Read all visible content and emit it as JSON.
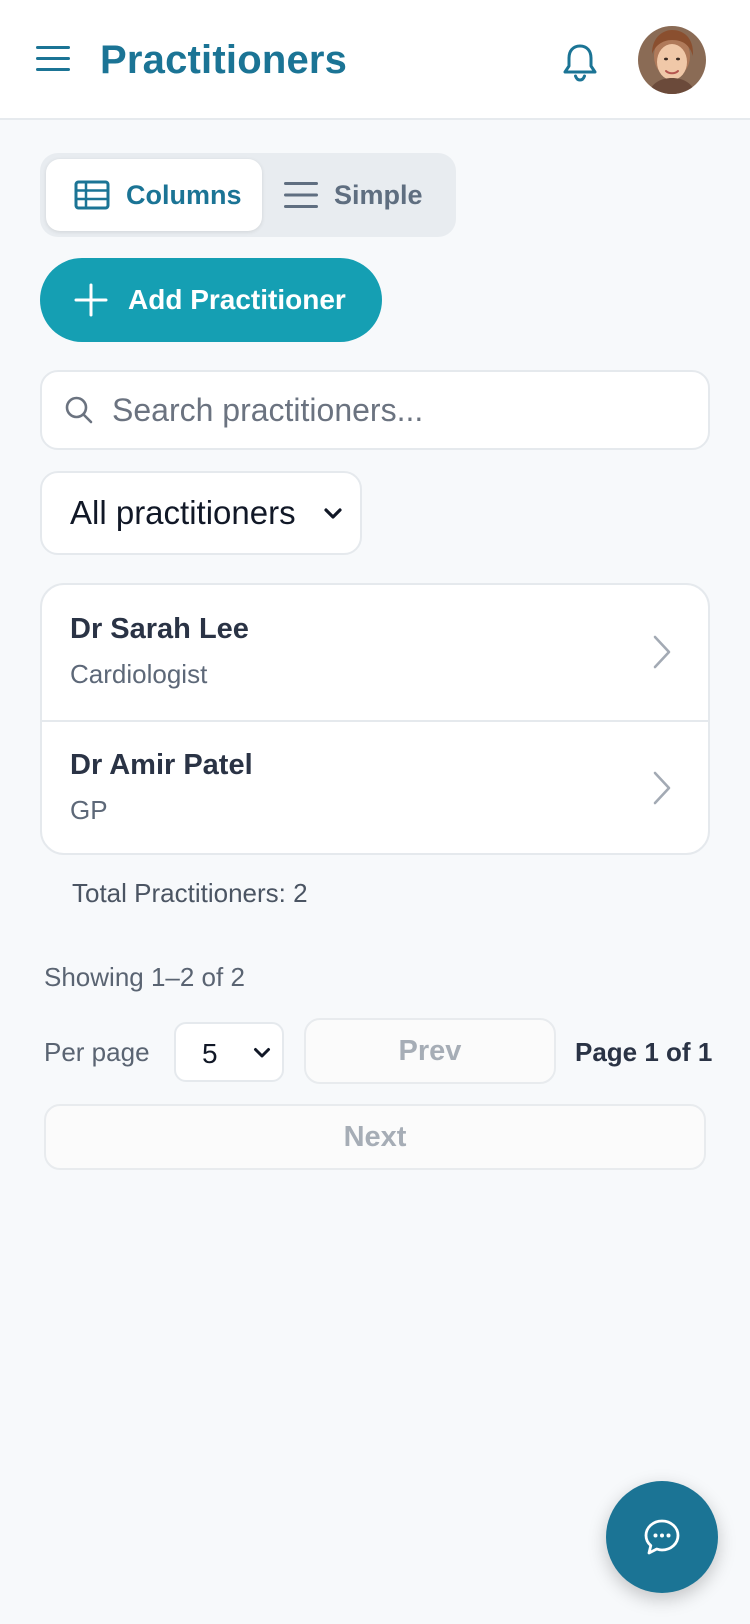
{
  "header": {
    "title": "Practitioners",
    "menu_icon": "hamburger-menu-icon",
    "notification_icon": "bell-icon",
    "avatar": "user-avatar"
  },
  "view_toggle": {
    "columns_label": "Columns",
    "simple_label": "Simple",
    "active": "Columns"
  },
  "actions": {
    "add_label": "Add Practitioner"
  },
  "search": {
    "placeholder": "Search practitioners...",
    "value": ""
  },
  "filter": {
    "selected": "All practitioners"
  },
  "practitioners": [
    {
      "name": "Dr Sarah Lee",
      "specialty": "Cardiologist"
    },
    {
      "name": "Dr Amir Patel",
      "specialty": "GP"
    }
  ],
  "summary": {
    "total_text": "Total Practitioners: 2"
  },
  "pagination": {
    "showing_text": "Showing 1–2 of 2",
    "per_page_label": "Per page",
    "per_page_value": "5",
    "prev_label": "Prev",
    "page_text": "Page 1 of 1",
    "next_label": "Next"
  },
  "colors": {
    "primary": "#1b7495",
    "accent": "#159fb3",
    "background": "#f7f9fb"
  }
}
